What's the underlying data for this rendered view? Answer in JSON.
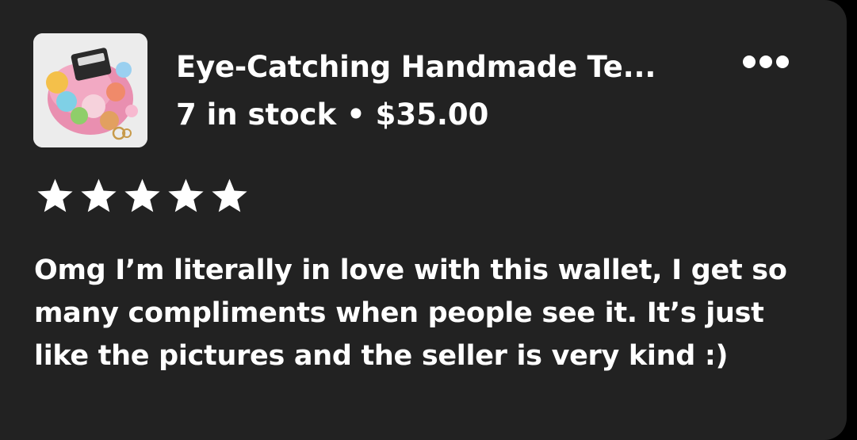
{
  "product": {
    "image_icon": "wallet-with-plush-toys-photo",
    "title": "Eye-Catching Handmade Te...",
    "stock": "7 in stock",
    "separator": "•",
    "price": "$35.00"
  },
  "actions": {
    "more_icon": "more-horizontal-icon"
  },
  "rating": {
    "stars": 5,
    "max": 5,
    "star_icon": "star-icon",
    "star_color": "#ffffff"
  },
  "review": {
    "text": "Omg I’m literally in love with this wallet, I get so many compliments when people see it. It’s just like the pictures and the seller is very kind :)"
  },
  "colors": {
    "card_background": "#222222",
    "page_background": "#000000",
    "text": "#ffffff"
  }
}
